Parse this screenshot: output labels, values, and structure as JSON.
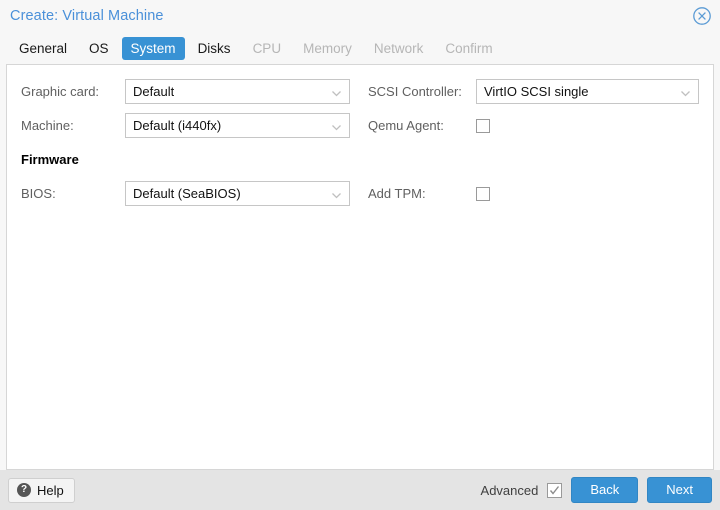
{
  "window": {
    "title": "Create: Virtual Machine",
    "close_icon": "close-circle-icon"
  },
  "tabs": [
    {
      "label": "General",
      "state": "enabled"
    },
    {
      "label": "OS",
      "state": "enabled"
    },
    {
      "label": "System",
      "state": "active"
    },
    {
      "label": "Disks",
      "state": "enabled"
    },
    {
      "label": "CPU",
      "state": "disabled"
    },
    {
      "label": "Memory",
      "state": "disabled"
    },
    {
      "label": "Network",
      "state": "disabled"
    },
    {
      "label": "Confirm",
      "state": "disabled"
    }
  ],
  "form": {
    "left": {
      "graphic_card": {
        "label": "Graphic card:",
        "value": "Default"
      },
      "machine": {
        "label": "Machine:",
        "value": "Default (i440fx)"
      },
      "firmware_section": "Firmware",
      "bios": {
        "label": "BIOS:",
        "value": "Default (SeaBIOS)"
      }
    },
    "right": {
      "scsi_controller": {
        "label": "SCSI Controller:",
        "value": "VirtIO SCSI single"
      },
      "qemu_agent": {
        "label": "Qemu Agent:",
        "checked": false
      },
      "add_tpm": {
        "label": "Add TPM:",
        "checked": false
      }
    }
  },
  "footer": {
    "help_label": "Help",
    "help_icon": "question-mark-icon",
    "advanced_label": "Advanced",
    "advanced_checked": true,
    "back_label": "Back",
    "next_label": "Next"
  },
  "colors": {
    "accent_blue": "#3892d4",
    "title_blue": "#4a90d9",
    "label_gray": "#606060",
    "disabled_gray": "#b6b6b6",
    "footer_gray": "#e4e4e4"
  }
}
